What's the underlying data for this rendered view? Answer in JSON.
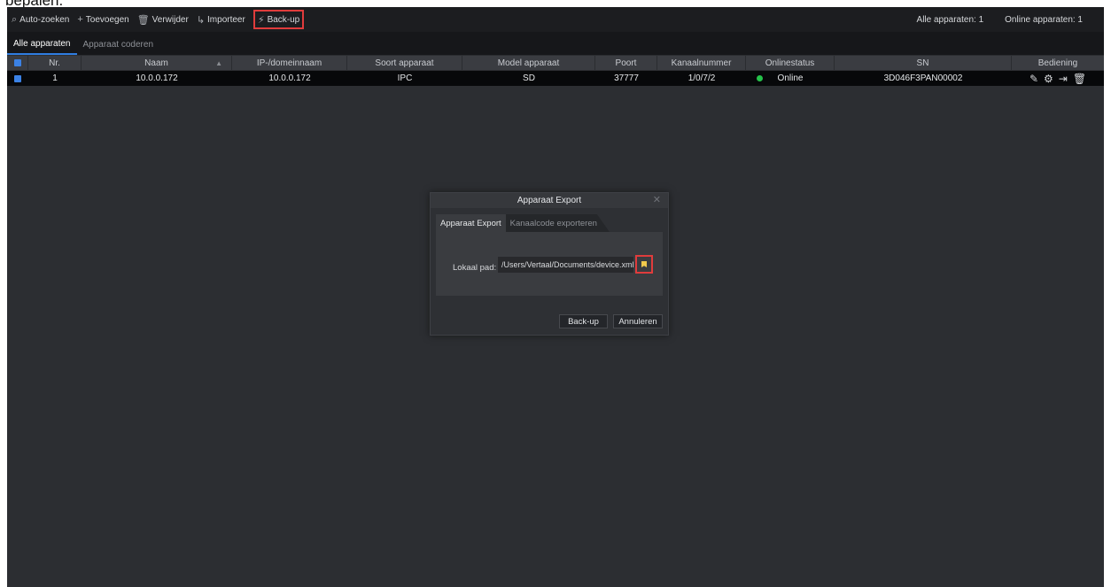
{
  "caption_fragment": "bepalen.",
  "toolbar": {
    "auto_search": "Auto-zoeken",
    "add": "Toevoegen",
    "delete": "Verwijder",
    "import": "Importeer",
    "backup": "Back-up",
    "all_devices_count": "Alle apparaten: 1",
    "online_devices_count": "Online apparaten: 1"
  },
  "tabs": [
    "Alle apparaten",
    "Apparaat coderen"
  ],
  "table": {
    "headers": [
      "Nr.",
      "Naam",
      "IP-/domeinnaam",
      "Soort apparaat",
      "Model apparaat",
      "Poort",
      "Kanaalnummer",
      "Onlinestatus",
      "SN",
      "Bediening"
    ],
    "rows": [
      {
        "nr": "1",
        "naam": "10.0.0.172",
        "ip": "10.0.0.172",
        "soort": "IPC",
        "model": "SD",
        "poort": "37777",
        "kanaal": "1/0/7/2",
        "status": "Online",
        "sn": "3D046F3PAN00002"
      }
    ]
  },
  "dialog": {
    "title": "Apparaat Export",
    "tab_export": "Apparaat Export",
    "tab_channel": "Kanaalcode exporteren",
    "path_label": "Lokaal pad:",
    "path_value": "/Users/Vertaal/Documents/device.xml",
    "backup_button": "Back-up",
    "cancel_button": "Annuleren"
  },
  "colors": {
    "accent": "#2f7de1",
    "highlight": "#e03c3c",
    "online": "#25c24a"
  }
}
